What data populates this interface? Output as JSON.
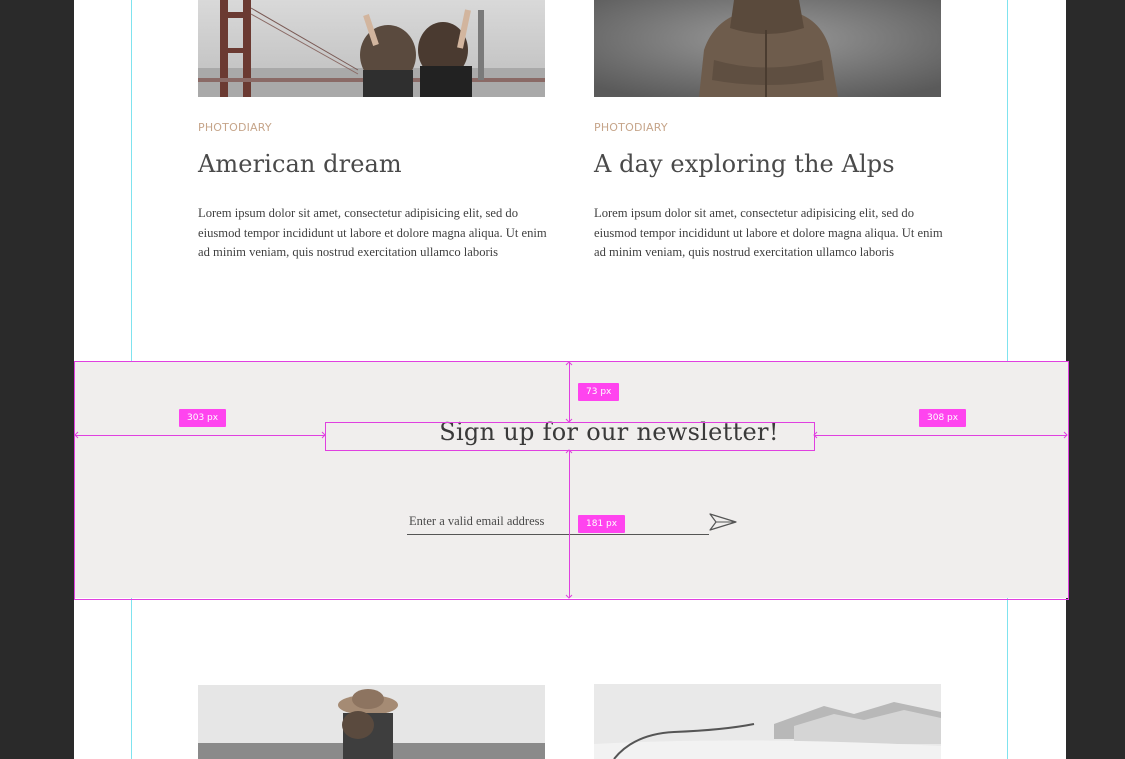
{
  "cards_top": [
    {
      "category": "PHOTODIARY",
      "title": "American dream",
      "excerpt": "Lorem ipsum dolor sit amet, consectetur adipisicing elit, sed do eiusmod tempor incididunt ut labore et dolore magna aliqua. Ut enim ad minim veniam, quis nostrud exercitation ullamco laboris"
    },
    {
      "category": "PHOTODIARY",
      "title": "A day exploring the Alps",
      "excerpt": "Lorem ipsum dolor sit amet, consectetur adipisicing elit, sed do eiusmod tempor incididunt ut labore et dolore magna aliqua. Ut enim ad minim veniam, quis nostrud exercitation ullamco laboris"
    }
  ],
  "newsletter": {
    "title": "Sign up for our newsletter!",
    "email_placeholder": "Enter a valid email address",
    "send_icon": "paper-plane-icon"
  },
  "measurements": {
    "top_gap": "73 px",
    "left_gap": "303 px",
    "right_gap": "308 px",
    "bottom_gap": "181 px"
  },
  "colors": {
    "page_background": "#2a2a2a",
    "canvas": "#ffffff",
    "newsletter_background": "#f0eeed",
    "category_accent": "#c6a58a",
    "guide_lines": "#7fe3ef",
    "measure_overlay": "#ff44ef"
  }
}
